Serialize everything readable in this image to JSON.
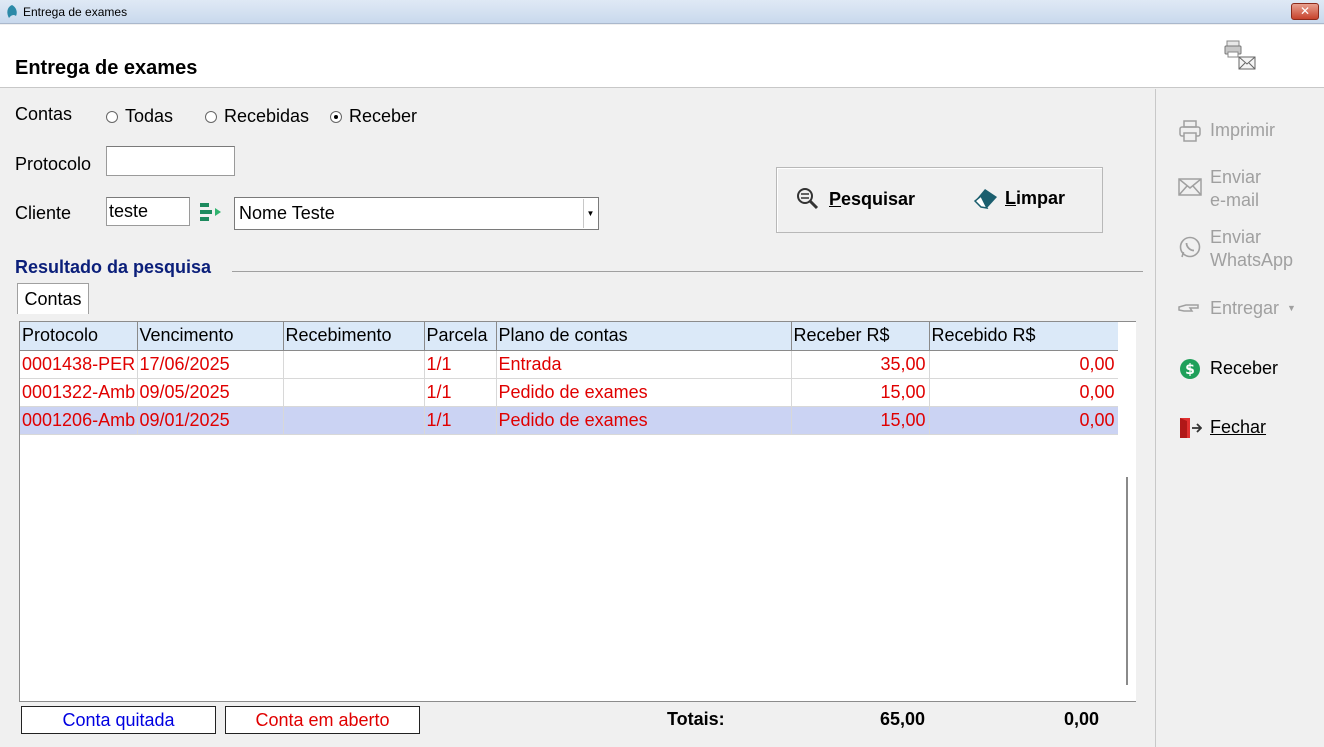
{
  "window": {
    "title": "Entrega de exames",
    "close_label": "✕"
  },
  "header": {
    "title": "Entrega de exames",
    "print_mail_icon": "print-mail-icon"
  },
  "filters": {
    "contas_label": "Contas",
    "options": [
      {
        "label": "Todas",
        "selected": false
      },
      {
        "label": "Recebidas",
        "selected": false
      },
      {
        "label": "Receber",
        "selected": true
      }
    ],
    "protocolo_label": "Protocolo",
    "protocolo_value": "",
    "cliente_label": "Cliente",
    "cliente_code": "teste",
    "cliente_name": "Nome Teste"
  },
  "actions": {
    "pesquisar": "Pesquisar",
    "limpar": "Limpar"
  },
  "results": {
    "section_title": "Resultado da pesquisa",
    "tab": "Contas",
    "columns": [
      "Protocolo",
      "Vencimento",
      "Recebimento",
      "Parcela",
      "Plano de contas",
      "Receber R$",
      "Recebido R$"
    ],
    "rows": [
      [
        "0001438-PER",
        "17/06/2025",
        "",
        "1/1",
        "Entrada",
        "35,00",
        "0,00"
      ],
      [
        "0001322-Amb",
        "09/05/2025",
        "",
        "1/1",
        "Pedido de exames",
        "15,00",
        "0,00"
      ],
      [
        "0001206-Amb",
        "09/01/2025",
        "",
        "1/1",
        "Pedido de exames",
        "15,00",
        "0,00"
      ]
    ],
    "selected_row": 2
  },
  "legend": {
    "paid": "Conta quitada",
    "open": "Conta em aberto",
    "paid_color": "#0000e0",
    "open_color": "#e00000"
  },
  "totals": {
    "label": "Totais:",
    "receber": "65,00",
    "recebido": "0,00"
  },
  "sidebar": {
    "imprimir": "Imprimir",
    "enviar_email_1": "Enviar",
    "enviar_email_2": "e-mail",
    "enviar_whatsapp_1": "Enviar",
    "enviar_whatsapp_2": "WhatsApp",
    "entregar": "Entregar",
    "receber": "Receber",
    "fechar": "Fechar"
  }
}
